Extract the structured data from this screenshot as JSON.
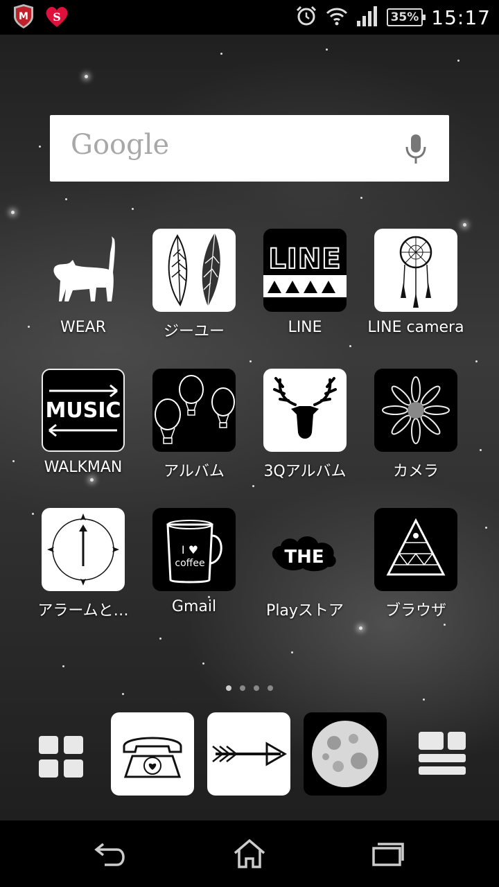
{
  "status_bar": {
    "time": "15:17",
    "battery": "35%",
    "notification_icons": [
      "mcafee-icon",
      "heart-s-icon"
    ],
    "system_icons": [
      "alarm-clock-icon",
      "wifi-icon",
      "signal-icon",
      "battery-icon"
    ]
  },
  "search": {
    "logo": "Google",
    "mic_icon": "mic-icon"
  },
  "apps": [
    {
      "label": "WEAR",
      "icon": "cat-icon"
    },
    {
      "label": "ジーユー",
      "icon": "feathers-icon"
    },
    {
      "label": "LINE",
      "icon": "line-icon"
    },
    {
      "label": "LINE camera",
      "icon": "dreamcatcher-icon"
    },
    {
      "label": "WALKMAN",
      "icon": "music-icon",
      "icon_text": "MUSIC"
    },
    {
      "label": "アルバム",
      "icon": "balloons-icon"
    },
    {
      "label": "3Qアルバム",
      "icon": "deer-icon"
    },
    {
      "label": "カメラ",
      "icon": "flower-icon"
    },
    {
      "label": "アラームと…",
      "icon": "clock-icon"
    },
    {
      "label": "Gmail",
      "icon": "coffee-mug-icon",
      "icon_text": "I ♥ coffee"
    },
    {
      "label": "Playストア",
      "icon": "the-cloud-icon",
      "icon_text": "THE"
    },
    {
      "label": "ブラウザ",
      "icon": "triangle-icon"
    }
  ],
  "line_icon_text": "LINE",
  "page_indicator": {
    "count": 4,
    "active": 0
  },
  "dock": [
    "apps-grid-icon",
    "phone-icon",
    "arrow-icon",
    "moon-icon",
    "widgets-icon"
  ],
  "nav": [
    "back-icon",
    "home-icon",
    "recents-icon"
  ]
}
